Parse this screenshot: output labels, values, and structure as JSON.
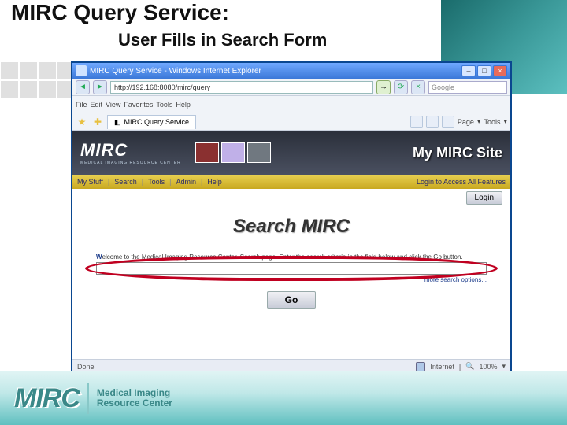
{
  "slide": {
    "title": "MIRC Query Service:",
    "subtitle": "User Fills in Search Form"
  },
  "browser": {
    "window_title": "MIRC Query Service - Windows Internet Explorer",
    "address": "http://192.168:8080/mirc/query",
    "search_placeholder": "Google",
    "tab_label": "MIRC Query Service",
    "menus": {
      "file": "File",
      "edit": "Edit",
      "view": "View",
      "favorites": "Favorites",
      "tools": "Tools",
      "help": "Help"
    },
    "toolbar": {
      "page": "Page",
      "tools": "Tools"
    }
  },
  "page": {
    "logo_big": "MIRC",
    "logo_small": "MEDICAL IMAGING RESOURCE CENTER",
    "site_title": "My MIRC Site",
    "nav": {
      "mystuff": "My Stuff",
      "search": "Search",
      "tools": "Tools",
      "admin": "Admin",
      "help": "Help",
      "login_prompt": "Login to Access All Features"
    },
    "login_label": "Login",
    "search_heading": "Search MIRC",
    "welcome_bold": "W",
    "welcome_text": "elcome to the Medical Imaging Resource Center. Search page. Enter the search criteria in the field below and click the Go button.",
    "more_options": "more search options...",
    "go_label": "Go"
  },
  "status": {
    "done": "Done",
    "zone": "Internet",
    "zoom": "100%"
  },
  "footer": {
    "mark": "MIRC",
    "line1": "Medical Imaging",
    "line2": "Resource Center"
  }
}
